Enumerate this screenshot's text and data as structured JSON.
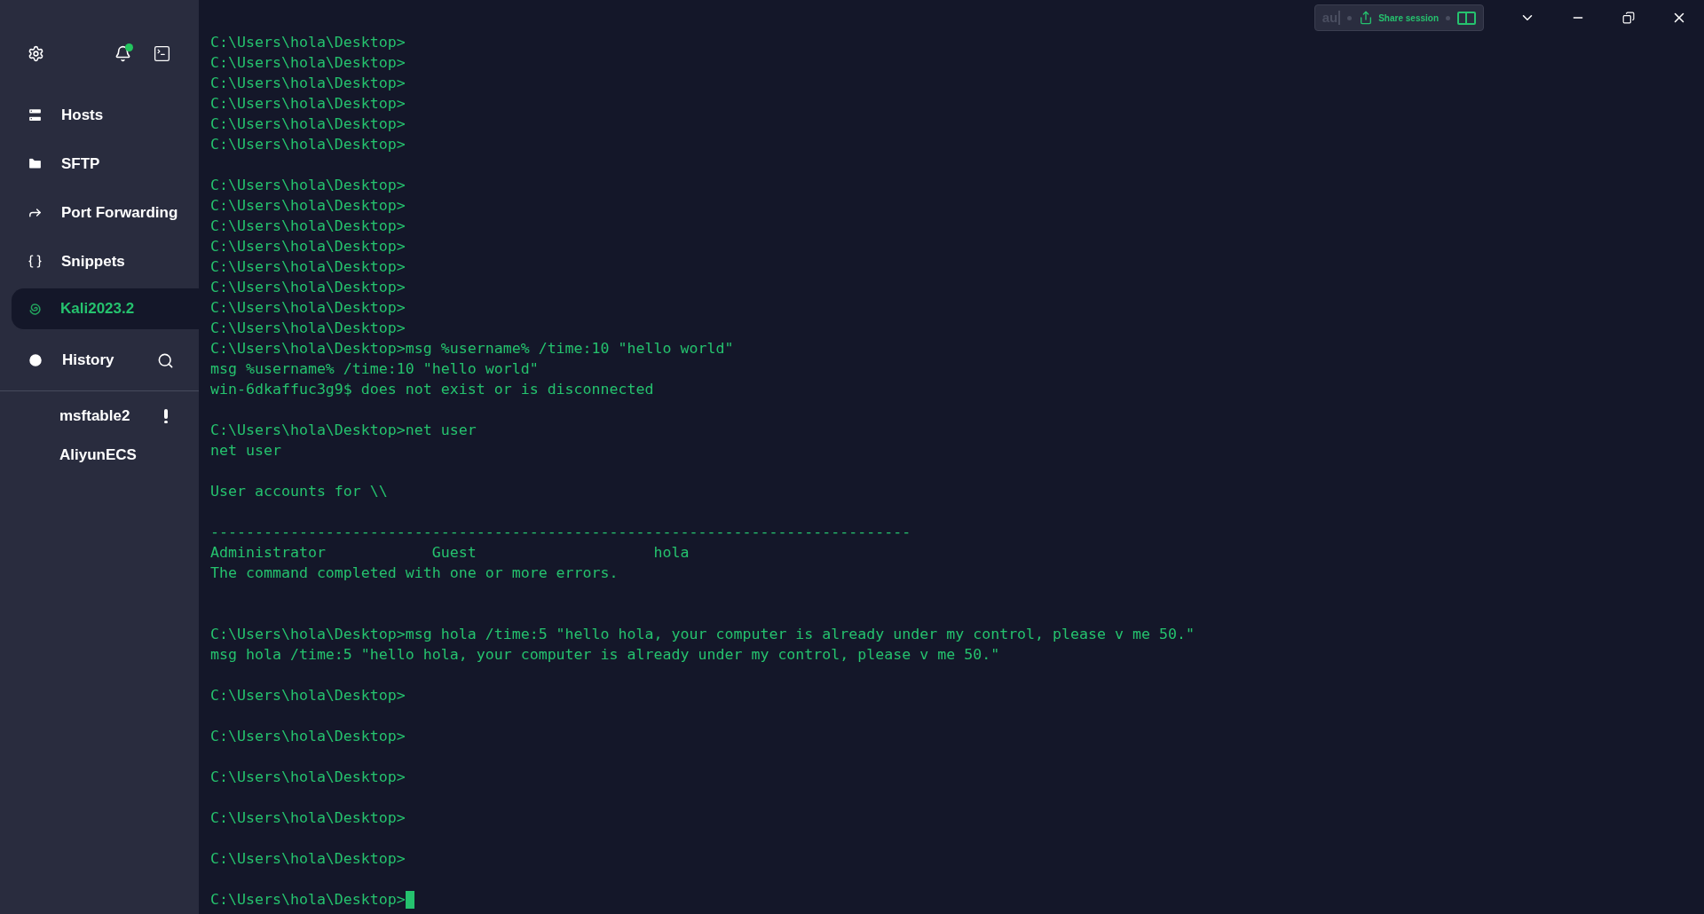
{
  "sidebar": {
    "notifications": {
      "unread": true
    },
    "nav": [
      {
        "label": "Hosts",
        "selected": false
      },
      {
        "label": "SFTP",
        "selected": false
      },
      {
        "label": "Port Forwarding",
        "selected": false
      },
      {
        "label": "Snippets",
        "selected": false
      },
      {
        "label": "Kali2023.2",
        "selected": true
      }
    ],
    "history": {
      "title": "History",
      "items": [
        {
          "label": "msftable2",
          "warning": true
        },
        {
          "label": "AliyunECS",
          "warning": false
        }
      ]
    }
  },
  "toolbar": {
    "field": {
      "value": "au"
    },
    "share_button": "Share session"
  },
  "terminal": {
    "cursor": true,
    "lines": [
      {
        "kind": "line",
        "text": "C:\\Users\\hola\\Desktop>"
      },
      {
        "kind": "line",
        "text": "C:\\Users\\hola\\Desktop>"
      },
      {
        "kind": "line",
        "text": "C:\\Users\\hola\\Desktop>"
      },
      {
        "kind": "line",
        "text": "C:\\Users\\hola\\Desktop>"
      },
      {
        "kind": "line",
        "text": "C:\\Users\\hola\\Desktop>"
      },
      {
        "kind": "line",
        "text": "C:\\Users\\hola\\Desktop>"
      },
      {
        "kind": "blank"
      },
      {
        "kind": "line",
        "text": "C:\\Users\\hola\\Desktop>"
      },
      {
        "kind": "line",
        "text": "C:\\Users\\hola\\Desktop>"
      },
      {
        "kind": "line",
        "text": "C:\\Users\\hola\\Desktop>"
      },
      {
        "kind": "line",
        "text": "C:\\Users\\hola\\Desktop>"
      },
      {
        "kind": "line",
        "text": "C:\\Users\\hola\\Desktop>"
      },
      {
        "kind": "line",
        "text": "C:\\Users\\hola\\Desktop>"
      },
      {
        "kind": "line",
        "text": "C:\\Users\\hola\\Desktop>"
      },
      {
        "kind": "line",
        "text": "C:\\Users\\hola\\Desktop>"
      },
      {
        "kind": "line",
        "text": "C:\\Users\\hola\\Desktop>msg %username% /time:10 \"hello world\""
      },
      {
        "kind": "line",
        "text": "msg %username% /time:10 \"hello world\""
      },
      {
        "kind": "line",
        "text": "win-6dkaffuc3g9$ does not exist or is disconnected"
      },
      {
        "kind": "blank"
      },
      {
        "kind": "line",
        "text": "C:\\Users\\hola\\Desktop>net user"
      },
      {
        "kind": "line",
        "text": "net user"
      },
      {
        "kind": "blank"
      },
      {
        "kind": "line",
        "text": "User accounts for \\\\"
      },
      {
        "kind": "blank"
      },
      {
        "kind": "line",
        "text": "-------------------------------------------------------------------------------"
      },
      {
        "kind": "line",
        "text": "Administrator            Guest                    hola"
      },
      {
        "kind": "line",
        "text": "The command completed with one or more errors."
      },
      {
        "kind": "blank"
      },
      {
        "kind": "blank"
      },
      {
        "kind": "line",
        "text": "C:\\Users\\hola\\Desktop>msg hola /time:5 \"hello hola, your computer is already under my control, please v me 50.\""
      },
      {
        "kind": "line",
        "text": "msg hola /time:5 \"hello hola, your computer is already under my control, please v me 50.\""
      },
      {
        "kind": "blank"
      },
      {
        "kind": "line",
        "text": "C:\\Users\\hola\\Desktop>"
      },
      {
        "kind": "blank"
      },
      {
        "kind": "line",
        "text": "C:\\Users\\hola\\Desktop>"
      },
      {
        "kind": "blank"
      },
      {
        "kind": "line",
        "text": "C:\\Users\\hola\\Desktop>"
      },
      {
        "kind": "blank"
      },
      {
        "kind": "line",
        "text": "C:\\Users\\hola\\Desktop>"
      },
      {
        "kind": "blank"
      },
      {
        "kind": "line",
        "text": "C:\\Users\\hola\\Desktop>"
      },
      {
        "kind": "blank"
      },
      {
        "kind": "line",
        "text": "C:\\Users\\hola\\Desktop>"
      }
    ]
  }
}
